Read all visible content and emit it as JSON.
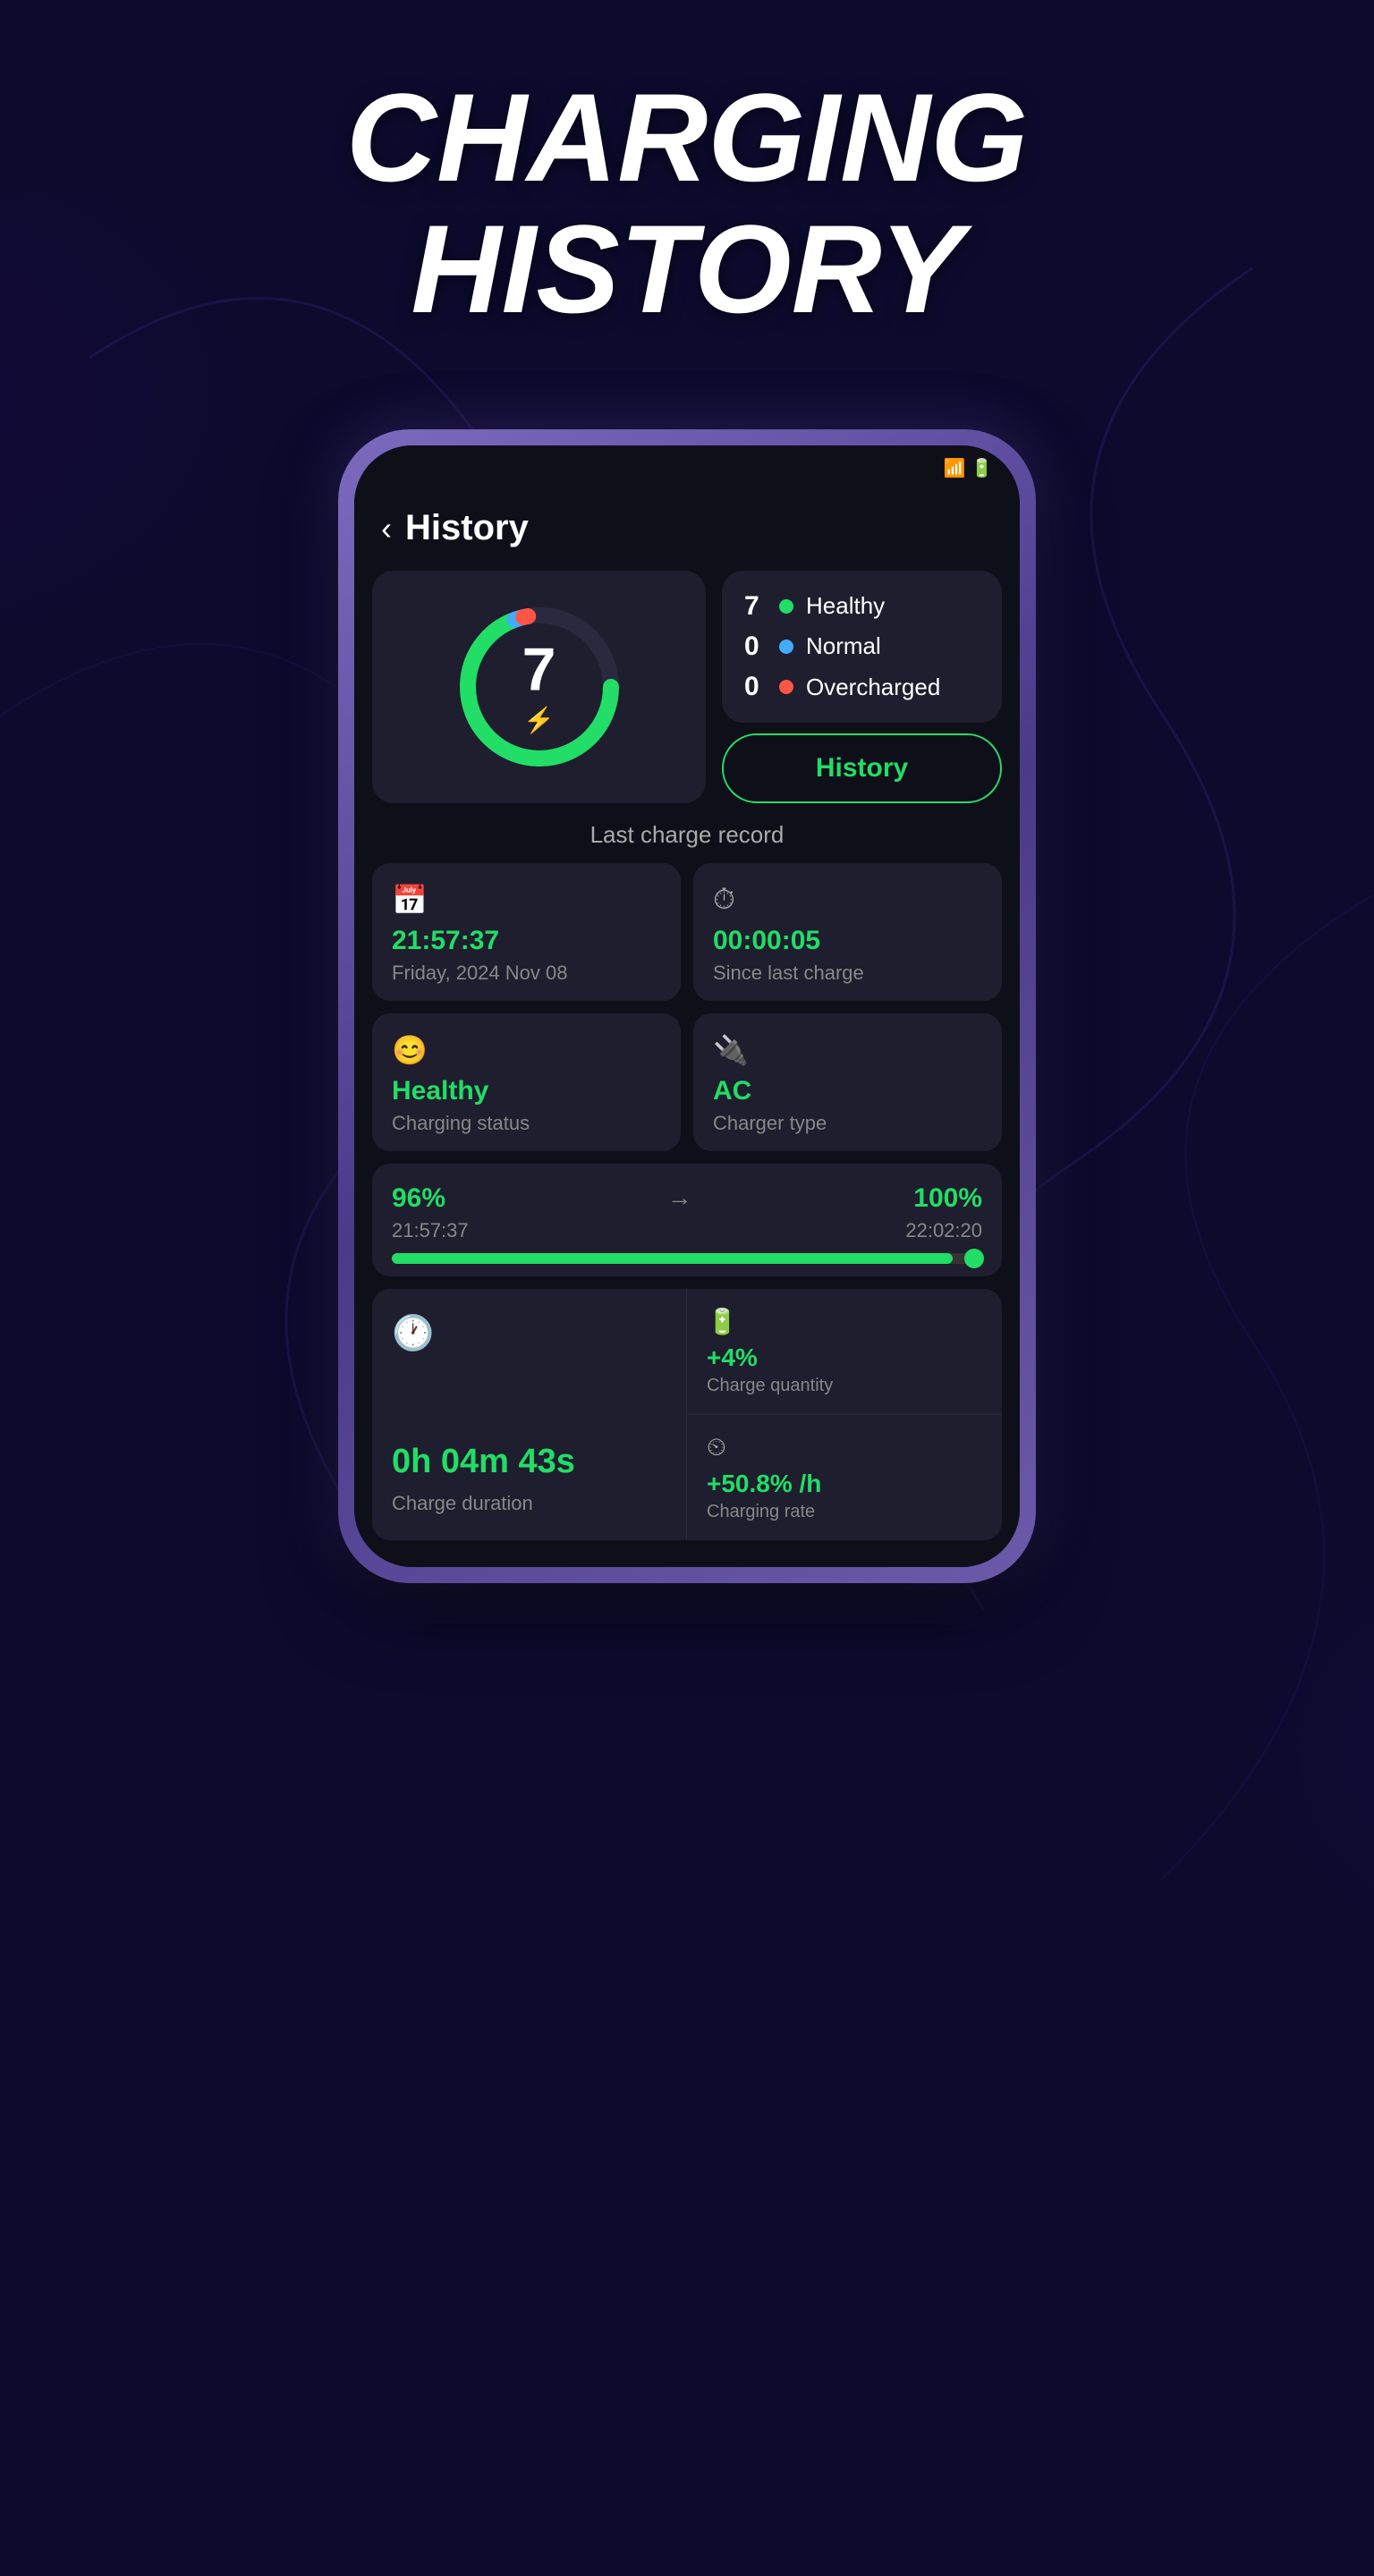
{
  "hero": {
    "title_line1": "CHARGING",
    "title_line2": "HISTORY"
  },
  "header": {
    "title": "History",
    "back_label": "‹"
  },
  "donut": {
    "value": "7",
    "icon": "⚡"
  },
  "legend": {
    "items": [
      {
        "count": "7",
        "label": "Healthy",
        "dot_class": "dot-green"
      },
      {
        "count": "0",
        "label": "Normal",
        "dot_class": "dot-blue"
      },
      {
        "count": "0",
        "label": "Overcharged",
        "dot_class": "dot-red"
      }
    ]
  },
  "history_button": "History",
  "last_charge": {
    "section_title": "Last charge record",
    "time_value": "21:57:37",
    "time_label": "Friday, 2024 Nov 08",
    "duration_since_value": "00:00:05",
    "duration_since_label": "Since last charge",
    "status_value": "Healthy",
    "status_label": "Charging status",
    "charger_value": "AC",
    "charger_label": "Charger type",
    "progress_start": "96%",
    "progress_start_time": "21:57:37",
    "progress_end": "100%",
    "progress_end_time": "22:02:20",
    "duration_icon": "🕐",
    "duration_value": "0h 04m 43s",
    "duration_label": "Charge duration",
    "charge_qty_value": "+4%",
    "charge_qty_label": "Charge quantity",
    "charge_rate_value": "+50.8% /h",
    "charge_rate_label": "Charging rate"
  },
  "colors": {
    "green": "#22dd66",
    "blue": "#44aaff",
    "red": "#ff5544",
    "bg_dark": "#0f0f1a",
    "card_bg": "#1e1e2e"
  }
}
